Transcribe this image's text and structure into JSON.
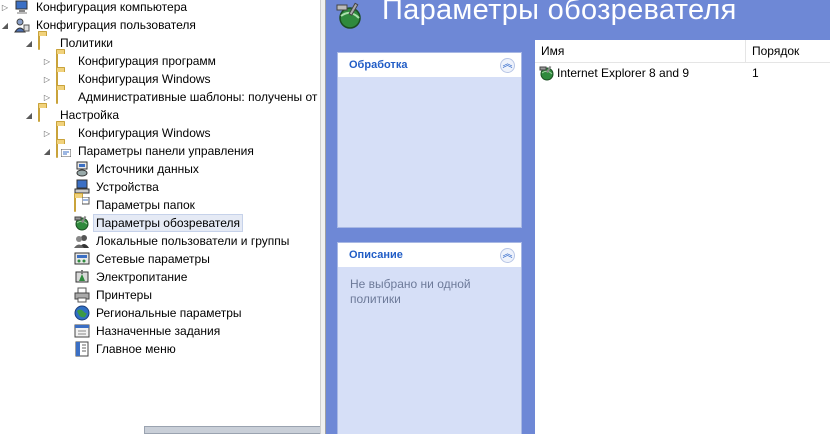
{
  "tree": {
    "items": [
      {
        "label": "Конфигурация компьютера",
        "expander": "closed",
        "icon": "computer-icon"
      },
      {
        "label": "Конфигурация пользователя",
        "expander": "open",
        "icon": "user-icon"
      },
      {
        "label": "Политики",
        "expander": "open",
        "icon": "folder-icon"
      },
      {
        "label": "Конфигурация программ",
        "expander": "closed",
        "icon": "folder-icon"
      },
      {
        "label": "Конфигурация Windows",
        "expander": "closed",
        "icon": "folder-icon"
      },
      {
        "label": "Административные шаблоны: получены от",
        "expander": "closed",
        "icon": "folder-icon"
      },
      {
        "label": "Настройка",
        "expander": "open",
        "icon": "folder-icon"
      },
      {
        "label": "Конфигурация Windows",
        "expander": "closed",
        "icon": "folder-icon"
      },
      {
        "label": "Параметры панели управления",
        "expander": "open",
        "icon": "control-panel-folder-icon"
      },
      {
        "label": "Источники данных",
        "icon": "data-sources-icon"
      },
      {
        "label": "Устройства",
        "icon": "devices-icon"
      },
      {
        "label": "Параметры папок",
        "icon": "folder-options-icon"
      },
      {
        "label": "Параметры обозревателя",
        "icon": "internet-settings-icon",
        "selected": true
      },
      {
        "label": "Локальные пользователи и группы",
        "icon": "local-users-icon"
      },
      {
        "label": "Сетевые параметры",
        "icon": "network-options-icon"
      },
      {
        "label": "Электропитание",
        "icon": "power-options-icon"
      },
      {
        "label": "Принтеры",
        "icon": "printers-icon"
      },
      {
        "label": "Региональные параметры",
        "icon": "regional-options-icon"
      },
      {
        "label": "Назначенные задания",
        "icon": "scheduled-tasks-icon"
      },
      {
        "label": "Главное меню",
        "icon": "start-menu-icon"
      }
    ]
  },
  "header": {
    "title": "Параметры обозревателя",
    "icon": "internet-settings-icon"
  },
  "tasks": {
    "processing": {
      "title": "Обработка",
      "collapse_icon": "double-chevron-up-icon"
    },
    "description": {
      "title": "Описание",
      "text": "Не выбрано ни одной политики",
      "collapse_icon": "double-chevron-up-icon"
    }
  },
  "list": {
    "columns": [
      "Имя",
      "Порядок"
    ],
    "rows": [
      {
        "name": "Internet Explorer 8 and 9",
        "order": "1",
        "icon": "internet-settings-icon"
      }
    ]
  },
  "colors": {
    "panel_background": "#6e88d6",
    "task_header_text": "#215dc6",
    "task_body": "#d6dff7"
  }
}
